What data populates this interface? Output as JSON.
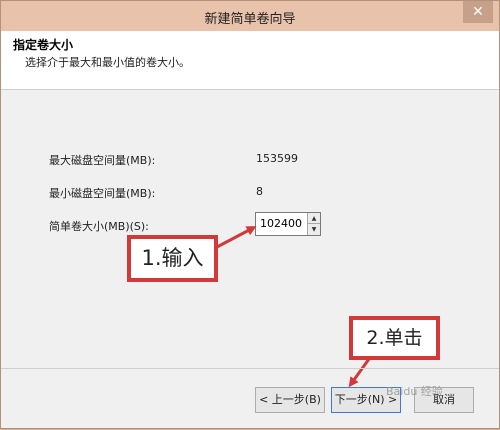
{
  "window": {
    "title": "新建简单卷向导"
  },
  "header": {
    "title": "指定卷大小",
    "subtitle": "选择介于最大和最小值的卷大小。"
  },
  "fields": {
    "max_label": "最大磁盘空间量(MB):",
    "max_value": "153599",
    "min_label": "最小磁盘空间量(MB):",
    "min_value": "8",
    "size_label": "简单卷大小(MB)(S):",
    "size_value": "102400"
  },
  "annotations": {
    "step1": "1.输入",
    "step2": "2.单击",
    "color": "#d23a3a"
  },
  "buttons": {
    "back": "< 上一步(B)",
    "next": "下一步(N) >",
    "cancel": "取消"
  },
  "watermark": "Baidu 经验",
  "icons": {
    "close": "close-icon",
    "spin_up": "chevron-up-icon",
    "spin_down": "chevron-down-icon"
  }
}
